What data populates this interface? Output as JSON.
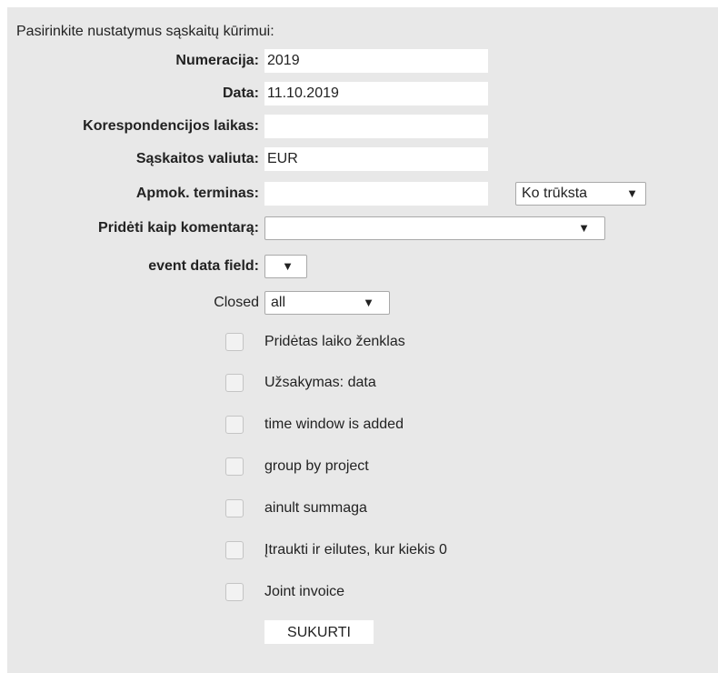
{
  "intro": "Pasirinkite nustatymus sąskaitų kūrimui:",
  "fields": {
    "numeration": {
      "label": "Numeracija:",
      "value": "2019"
    },
    "date": {
      "label": "Data:",
      "value": "11.10.2019"
    },
    "correspondence_time": {
      "label": "Korespondencijos laikas:",
      "value": ""
    },
    "currency": {
      "label": "Sąskaitos valiuta:",
      "value": "EUR"
    },
    "payment_term": {
      "label": "Apmok. terminas:",
      "value": "",
      "dropdown": "Ko trūksta"
    },
    "comment": {
      "label": "Pridėti kaip komentarą:",
      "value": ""
    },
    "event_data_field": {
      "label": "event data field:",
      "value": ""
    },
    "closed": {
      "label": "Closed",
      "value": "all"
    }
  },
  "checkboxes": [
    {
      "label": "Pridėtas laiko ženklas",
      "checked": false
    },
    {
      "label": "Užsakymas: data",
      "checked": false
    },
    {
      "label": "time window is added",
      "checked": false
    },
    {
      "label": "group by project",
      "checked": false
    },
    {
      "label": "ainult summaga",
      "checked": false
    },
    {
      "label": "Įtraukti ir eilutes, kur kiekis 0",
      "checked": false
    },
    {
      "label": "Joint invoice",
      "checked": false
    }
  ],
  "submit_label": "SUKURTI",
  "icons": {
    "dropdown_arrow": "▼"
  }
}
